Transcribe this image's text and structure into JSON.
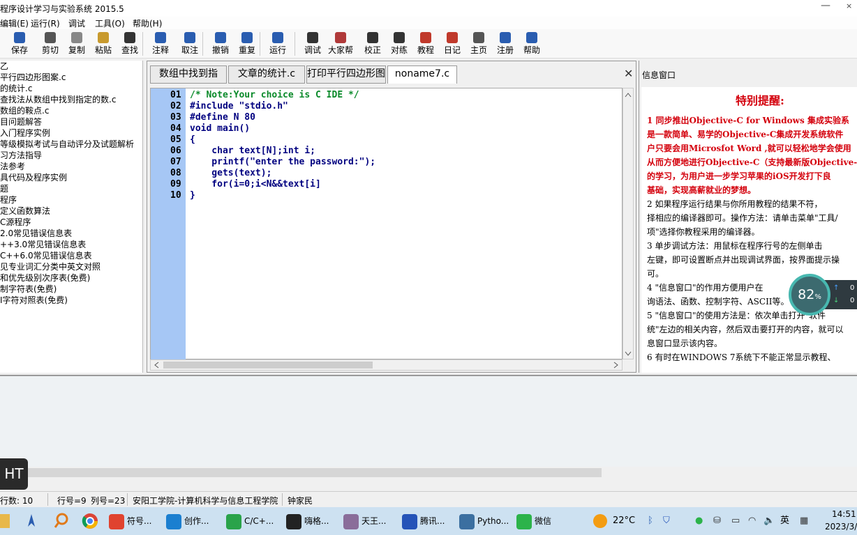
{
  "window": {
    "title": "程序设计学习与实验系统 2015.5",
    "minimize": "—",
    "close": "×"
  },
  "menu": [
    "编辑(E)",
    "运行(R)",
    "调试",
    "工具(O)",
    "帮助(H)"
  ],
  "toolbar": [
    {
      "label": "保存",
      "icon": "save-icon",
      "color": "#2a5db0"
    },
    {
      "label": "剪切",
      "icon": "scissors-icon",
      "color": "#555555"
    },
    {
      "label": "复制",
      "icon": "copy-icon",
      "color": "#888888"
    },
    {
      "label": "粘贴",
      "icon": "paste-icon",
      "color": "#c89a2e"
    },
    {
      "label": "查找",
      "icon": "binoculars-icon",
      "color": "#333333"
    },
    {
      "label": "注释",
      "icon": "comment-icon",
      "color": "#2a5db0"
    },
    {
      "label": "取注",
      "icon": "uncomment-icon",
      "color": "#2a5db0"
    },
    {
      "label": "撤销",
      "icon": "undo-icon",
      "color": "#2a5db0"
    },
    {
      "label": "重复",
      "icon": "redo-icon",
      "color": "#2a5db0"
    },
    {
      "label": "运行",
      "icon": "run-icon",
      "color": "#2a5db0"
    },
    {
      "label": "调试",
      "icon": "debug-icon",
      "color": "#333333"
    },
    {
      "label": "大家帮",
      "icon": "people-icon",
      "color": "#b03a3a"
    },
    {
      "label": "校正",
      "icon": "check-icon",
      "color": "#333333"
    },
    {
      "label": "对练",
      "icon": "edit-icon",
      "color": "#333333"
    },
    {
      "label": "教程",
      "icon": "books-icon",
      "color": "#c0392b"
    },
    {
      "label": "日记",
      "icon": "calendar-icon",
      "color": "#c0392b"
    },
    {
      "label": "主页",
      "icon": "home-icon",
      "color": "#555555"
    },
    {
      "label": "注册",
      "icon": "pen-icon",
      "color": "#2a5db0"
    },
    {
      "label": "帮助",
      "icon": "help-icon",
      "color": "#2a5db0"
    }
  ],
  "sidebar": {
    "items": [
      "乙",
      "平行四边形图案.c",
      "的统计.c",
      "查找法从数组中找到指定的数.c",
      "数组的鞍点.c",
      "目问题解答",
      "入门程序实例",
      "等级模拟考试与自动评分及试题解析",
      "习方法指导",
      "法参考",
      "具代码及程序实例",
      "题",
      "程序",
      "定义函数算法",
      "C源程序",
      "2.0常见错误信息表",
      "++3.0常见错误信息表",
      "C++6.0常见错误信息表",
      "见专业词汇分类中英文对照",
      "和优先级别次序表(免费)",
      "制字符表(免费)",
      "I字符对照表(免费)"
    ]
  },
  "editor": {
    "tabs": [
      "数组中找到指",
      "文章的统计.c",
      "打印平行四边形图案.c",
      "noname7.c"
    ],
    "close": "✕",
    "lines": [
      {
        "n": "01",
        "text": "/* Note:Your choice is C IDE */",
        "color": "#0a8a2a"
      },
      {
        "n": "02",
        "text": "#include \"stdio.h\"",
        "color": "#000080"
      },
      {
        "n": "03",
        "text": "#define N 80",
        "color": "#000080"
      },
      {
        "n": "04",
        "text": "void main()",
        "color": "#000080"
      },
      {
        "n": "05",
        "text": "{",
        "color": "#000080"
      },
      {
        "n": "06",
        "text": "    char text[N];int i;",
        "color": "#000080"
      },
      {
        "n": "07",
        "text": "    printf(\"enter the password:\");",
        "color": "#000080"
      },
      {
        "n": "08",
        "text": "    gets(text);",
        "color": "#000080"
      },
      {
        "n": "09",
        "text": "    for(i=0;i<N&&text[i]",
        "color": "#000080"
      },
      {
        "n": "10",
        "text": "}",
        "color": "#000080"
      }
    ]
  },
  "info": {
    "title": "信息窗口",
    "heading": "特别提醒:",
    "red_lines": [
      "1  同步推出Objective-C for Windows 集成实验系",
      "是一款简单、易学的Objective-C集成开发系统软件",
      "户只要会用Microsfot Word ,就可以轻松地学会使用",
      "从而方便地进行Objective-C（支持最新版Objective-",
      "的学习，为用户进一步学习苹果的iOS开发打下良",
      "基础，实现高薪就业的梦想。"
    ],
    "black_lines": [
      "   2  如果程序运行结果与你所用教程的结果不符，",
      "择相应的编译器即可。操作方法：请单击菜单\"工具/",
      "项\"选择你教程采用的编译器。",
      "   3  单步调试方法：用鼠标在程序行号的左侧单击",
      "左键，即可设置断点并出现调试界面，按界面提示操",
      "可。",
      "   4  \"信息窗口\"的作用方便用户在",
      "询语法、函数、控制字符、ASCII等。",
      "   5  \"信息窗口\"的使用方法是：依次单击打开\"软件",
      "统\"左边的相关内容，然后双击要打开的内容，就可以",
      "息窗口显示该内容。",
      "   6  有时在WINDOWS 7系统下不能正常显示教程、"
    ]
  },
  "overlay": {
    "percent": "82",
    "unit": "%",
    "up": "0",
    "down": "0",
    "ht": "HT"
  },
  "status": {
    "rows": "行数:  10",
    "line": "行号=9",
    "col": "列号=23",
    "org": "安阳工学院-计算机科学与信息工程学院",
    "author": "钟家民"
  },
  "taskbar": {
    "apps": [
      {
        "label": "符号...",
        "icon": "wps-icon",
        "color": "#e0432f"
      },
      {
        "label": "创作...",
        "icon": "edge-icon",
        "color": "#1b7fd0"
      },
      {
        "label": "C/C+...",
        "icon": "c-ide-icon",
        "color": "#2aa34a"
      },
      {
        "label": "嗨格...",
        "icon": "camera-icon",
        "color": "#222222"
      },
      {
        "label": "天王...",
        "icon": "tianwang-icon",
        "color": "#8a6d9a"
      },
      {
        "label": "腾讯...",
        "icon": "shield-icon",
        "color": "#2453b8"
      },
      {
        "label": "Pytho...",
        "icon": "python-icon",
        "color": "#3b6fa0"
      },
      {
        "label": "微信",
        "icon": "wechat-icon",
        "color": "#2cb34a"
      }
    ],
    "weather": "22°C",
    "lang": "英",
    "time": "14:51",
    "date": "2023/3/"
  }
}
